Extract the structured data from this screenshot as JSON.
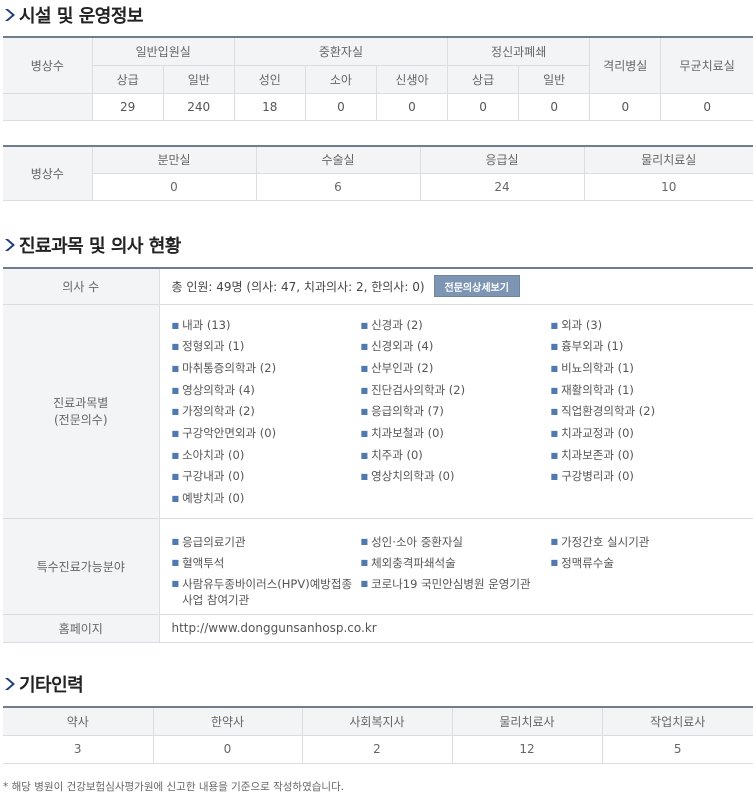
{
  "sections": {
    "facility_title": "시설 및 운영정보",
    "doctor_title": "진료과목 및 의사 현황",
    "other_title": "기타인력"
  },
  "facility": {
    "row_label": "병상수",
    "groups": [
      "일반입원실",
      "중환자실",
      "정신과폐쇄",
      "격리병실",
      "무균치료실"
    ],
    "subheaders": [
      "상급",
      "일반",
      "성인",
      "소아",
      "신생아",
      "상급",
      "일반"
    ],
    "values": [
      "29",
      "240",
      "18",
      "0",
      "0",
      "0",
      "0",
      "0",
      "0"
    ]
  },
  "special_rooms": {
    "row_label": "병상수",
    "headers": [
      "분만실",
      "수술실",
      "응급실",
      "물리치료실"
    ],
    "values": [
      "0",
      "6",
      "24",
      "10"
    ]
  },
  "doctors": {
    "count_label": "의사 수",
    "count_text": "총 인원: 49명 (의사: 47, 치과의사: 2, 한의사: 0)",
    "detail_button": "전문의상세보기",
    "dept_label_line1": "진료과목별",
    "dept_label_line2": "(전문의수)",
    "bullet": "■",
    "departments": [
      "내과 (13)",
      "신경과 (2)",
      "외과 (3)",
      "정형외과 (1)",
      "신경외과 (4)",
      "흉부외과 (1)",
      "마취통증의학과 (2)",
      "산부인과 (2)",
      "비뇨의학과 (1)",
      "영상의학과 (4)",
      "진단검사의학과 (2)",
      "재활의학과 (1)",
      "가정의학과 (2)",
      "응급의학과 (7)",
      "직업환경의학과 (2)",
      "구강악안면외과 (0)",
      "치과보철과 (0)",
      "치과교정과 (0)",
      "소아치과 (0)",
      "치주과 (0)",
      "치과보존과 (0)",
      "구강내과 (0)",
      "영상치의학과 (0)",
      "구강병리과 (0)",
      "예방치과 (0)"
    ],
    "special_label": "특수진료가능분야",
    "special_fields": [
      "응급의료기관",
      "성인·소아 중환자실",
      "가정간호 실시기관",
      "혈액투석",
      "체외충격파쇄석술",
      "정맥류수술",
      "사람유두종바이러스(HPV)예방접종사업 참여기관",
      "코로나19 국민안심병원 운영기관"
    ],
    "homepage_label": "홈페이지",
    "homepage_url": "http://www.donggunsanhosp.co.kr"
  },
  "other_staff": {
    "headers": [
      "약사",
      "한약사",
      "사회복지사",
      "물리치료사",
      "작업치료사"
    ],
    "values": [
      "3",
      "0",
      "2",
      "12",
      "5"
    ]
  },
  "footnote": "* 해당 병원이 건강보험심사평가원에 신고한 내용을 기준으로 작성하였습니다.",
  "colors": {
    "accent": "#4f79b0",
    "table_top_border": "#6f7d8e",
    "header_bg": "#f3f4f6",
    "button_bg": "#7b95b3"
  },
  "icons": {
    "section_marker": "chevron-right-icon"
  }
}
